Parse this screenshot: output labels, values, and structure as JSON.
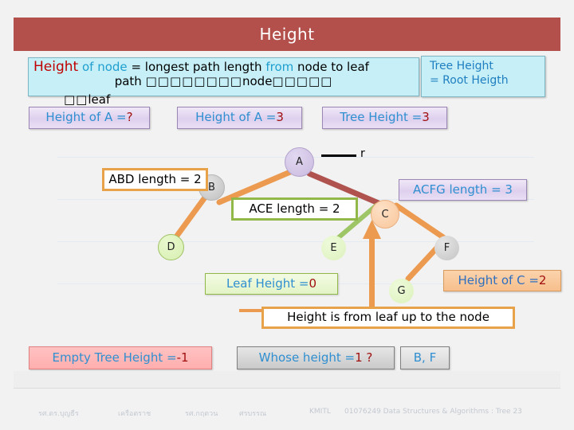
{
  "title": "Height",
  "definition": {
    "line1_a": "Height",
    "line1_b": "of node",
    "line1_c": "=",
    "line1_d": "longest path length",
    "line1_e": "from",
    "line1_f": "node to leaf",
    "line2_a": "path",
    "line2_tofu1": "□□□□□□□□",
    "line2_node": "node",
    "line2_tofu2": "□□□□□",
    "line3_tofu": "□□",
    "line3_leaf": "leaf"
  },
  "tree_height_note": {
    "line1": "Tree Height",
    "line2": "=  Root Heigth"
  },
  "callouts": {
    "height_a_question": {
      "label": "Height of A = ",
      "value": "?"
    },
    "height_a_answer": {
      "label": "Height of A = ",
      "value": "3"
    },
    "tree_height_3": {
      "label": "Tree Height = ",
      "value": "3"
    },
    "abd_length": {
      "text": "ABD length = 2"
    },
    "ace_length": {
      "text": "ACE  length = 2"
    },
    "acfg_length": {
      "text": "ACFG length = 3"
    },
    "leaf_height": {
      "label": "Leaf Height = ",
      "value": "0"
    },
    "height_of_c": {
      "label": "Height of C = ",
      "value": "2"
    },
    "height_from_leaf": {
      "text": "Height is from leaf up to the node"
    },
    "empty_tree_height": {
      "label": "Empty Tree Height = ",
      "value": "-1"
    },
    "whose_height": {
      "label": "Whose height = ",
      "value": "1 ?"
    },
    "answer_bf": {
      "text": "B, F"
    }
  },
  "tree": {
    "root_pointer_label": "r",
    "nodes": [
      {
        "id": "A",
        "label": "A"
      },
      {
        "id": "B",
        "label": "B"
      },
      {
        "id": "C",
        "label": "C"
      },
      {
        "id": "D",
        "label": "D"
      },
      {
        "id": "E",
        "label": "E"
      },
      {
        "id": "F",
        "label": "F"
      },
      {
        "id": "G",
        "label": "G"
      }
    ]
  },
  "footer": {
    "author1": "รศ.ดร.บุญธีร",
    "author1_last": "เครือตราช",
    "author2": "รศ.กฤตวน",
    "author2_last": "ศรบรรณ",
    "institute": "KMITL",
    "course": "01076249 Data Structures & Algorithms : Tree 23"
  },
  "colors": {
    "title_bar": "#b3504b",
    "cyan_box": "#c6eff7",
    "lavender_box": "#ded0ee",
    "orange_border": "#e8a249",
    "green_border": "#92b84a",
    "pink_box": "#ffc2c2",
    "accent_blue": "#2f8fd0",
    "value_red": "#a01010"
  }
}
